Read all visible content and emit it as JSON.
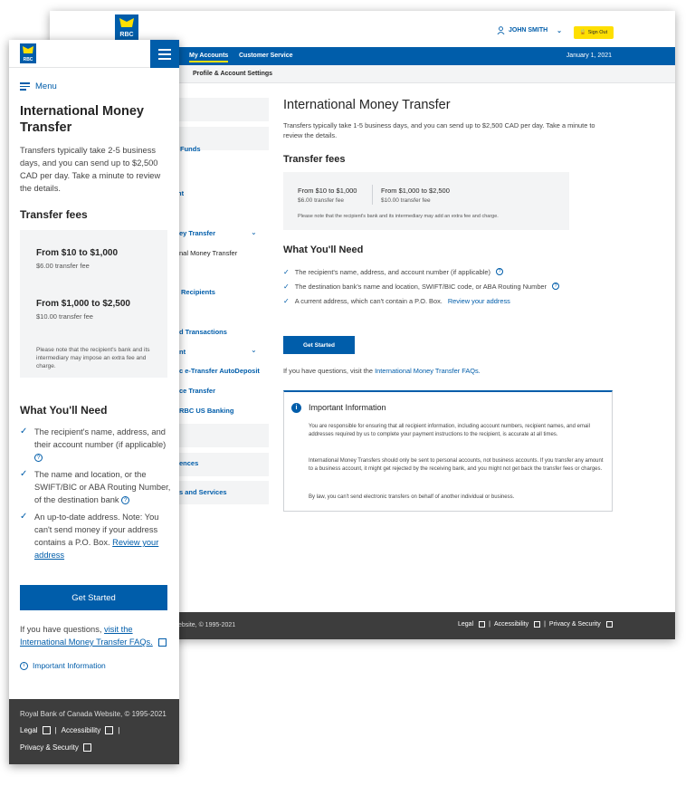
{
  "brand": {
    "logo_text": "RBC",
    "primary": "#005daa",
    "accent": "#fedf01"
  },
  "desktop": {
    "user_name": "JOHN SMITH",
    "sign_out": "Sign Out",
    "nav": {
      "tab_accounts": "My Accounts",
      "tab_service": "Customer Service",
      "date": "January 1, 2021"
    },
    "subnav": "Profile & Account Settings",
    "sidebar": [
      "r Funds",
      "nt",
      "ey Transfer",
      "nal Money Transfer",
      "Recipients",
      "d Transactions",
      "nt",
      "c e-Transfer AutoDeposit",
      "ce Transfer",
      "RBC US Banking",
      "ences",
      "s and Services"
    ],
    "title": "International Money Transfer",
    "intro": "Transfers typically take 1-5 business days, and you can send up to $2,500 CAD per day. Take a minute to review the details.",
    "fees_title": "Transfer fees",
    "fees": [
      {
        "range": "From $10 to $1,000",
        "fee": "$6.00 transfer fee"
      },
      {
        "range": "From $1,000 to $2,500",
        "fee": "$10.00 transfer fee"
      }
    ],
    "fees_note": "Please note that the recipient's bank and its intermediary may add an extra fee and charge.",
    "need_title": "What You'll Need",
    "needs": [
      "The recipient's name, address, and account number (if applicable)",
      "The destination bank's name and location, SWIFT/BIC code, or ABA Routing Number",
      "A current address, which can't contain a P.O. Box."
    ],
    "review_link": "Review your address",
    "button": "Get Started",
    "faq_prefix": "If you have questions, visit the",
    "faq_link": "International Money Transfer FAQs.",
    "info_title": "Important Information",
    "info_p1": "You are responsible for ensuring that all recipient information, including account numbers, recipient names, and email addresses required by us to complete your payment instructions to the recipient, is accurate at all times.",
    "info_p2": "International Money Transfers should only be sent to personal accounts, not business accounts. If you transfer any amount to a business account, it might get rejected by the receiving bank, and you might not get back the transfer fees or charges.",
    "info_p3": "By law, you can't send electronic transfers on behalf of another individual or business.",
    "footer_copy": "ebsite, © 1995-2021",
    "footer_links": [
      "Legal",
      "Accessibility",
      "Privacy & Security"
    ],
    "sep": "|"
  },
  "mobile": {
    "menu": "Menu",
    "title": "International Money Transfer",
    "intro": "Transfers typically take 2-5 business days, and you can send up to $2,500 CAD per day. Take a minute to review the details.",
    "fees_title": "Transfer fees",
    "fees": [
      {
        "range": "From $10 to $1,000",
        "fee": "$6.00 transfer fee"
      },
      {
        "range": "From $1,000 to $2,500",
        "fee": "$10.00 transfer fee"
      }
    ],
    "fees_note": "Please note that the recipient's bank and its intermediary may impose an extra fee and charge.",
    "need_title": "What You'll Need",
    "needs": [
      "The recipient's name, address, and their account number (if applicable)",
      "The name and location, or the SWIFT/BIC or ABA Routing Number, of the destination bank",
      "An up-to-date address. Note: You can't send money if your address contains a P.O. Box."
    ],
    "review_link": "Review your address",
    "button": "Get Started",
    "faq_prefix": "If you have questions,",
    "faq_link": "visit the International Money Transfer FAQs.",
    "important": "Important Information",
    "footer_copy": "Royal Bank of Canada Website, © 1995-2021",
    "footer_links": [
      "Legal",
      "Accessibility",
      "Privacy & Security"
    ],
    "sep": "|"
  }
}
